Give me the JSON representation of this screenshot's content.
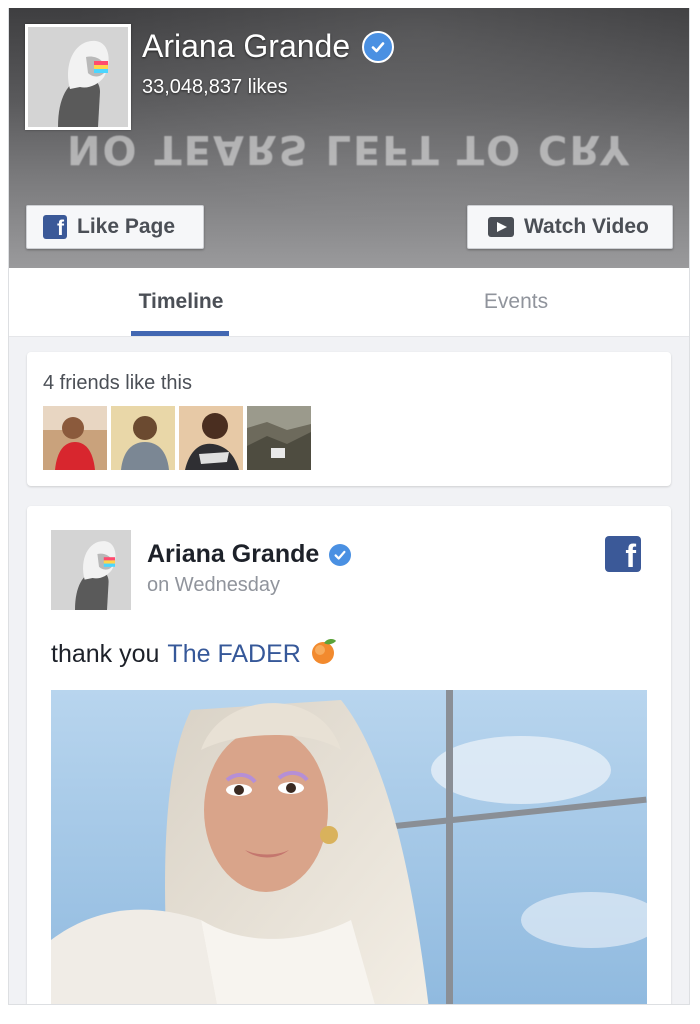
{
  "page": {
    "name": "Ariana Grande",
    "likes": "33,048,837 likes",
    "cover_text": "NO TEARS LEFT TO CRY"
  },
  "buttons": {
    "like_page": "Like Page",
    "watch_video": "Watch Video"
  },
  "tabs": [
    {
      "label": "Timeline",
      "active": true
    },
    {
      "label": "Events",
      "active": false
    }
  ],
  "friends": {
    "text": "4 friends like this",
    "count": 4
  },
  "post": {
    "author": "Ariana Grande",
    "time": "on Wednesday",
    "text_prefix": "thank you",
    "link_text": "The FADER"
  },
  "colors": {
    "facebook_blue": "#3b5998",
    "tab_accent": "#4267b2",
    "verified_blue": "#4a90e2",
    "link": "#365899"
  },
  "icons": [
    "verified-badge-icon",
    "facebook-f-icon",
    "play-video-icon",
    "peach-emoji-icon"
  ]
}
